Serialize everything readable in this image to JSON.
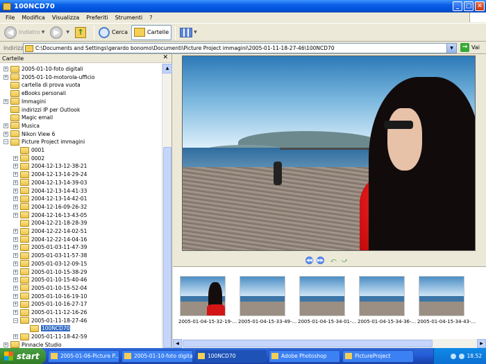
{
  "window": {
    "title": "100NCD70"
  },
  "menu": [
    "File",
    "Modifica",
    "Visualizza",
    "Preferiti",
    "Strumenti",
    "?"
  ],
  "toolbar": {
    "back": "Indietro",
    "search": "Cerca",
    "folders": "Cartelle"
  },
  "address": {
    "label": "Indirizzo",
    "path": "C:\\Documents and Settings\\gerardo bonomo\\Documenti\\Picture Project immagini\\2005-01-11-18-27-46\\100NCD70",
    "go": "Vai"
  },
  "left_pane": {
    "title": "Cartelle"
  },
  "tree": [
    {
      "label": "2005-01-10-foto digitali",
      "level": 1,
      "expand": "+"
    },
    {
      "label": "2005-01-10-motorola-ufficio",
      "level": 1,
      "expand": "+"
    },
    {
      "label": "cartella di prova vuota",
      "level": 1,
      "expand": ""
    },
    {
      "label": "eBooks personali",
      "level": 1,
      "expand": ""
    },
    {
      "label": "Immagini",
      "level": 1,
      "expand": "+"
    },
    {
      "label": "indirizzi IP per Outlook",
      "level": 1,
      "expand": ""
    },
    {
      "label": "Magic email",
      "level": 1,
      "expand": ""
    },
    {
      "label": "Musica",
      "level": 1,
      "expand": "+"
    },
    {
      "label": "Nikon View 6",
      "level": 1,
      "expand": "+"
    },
    {
      "label": "Picture Project immagini",
      "level": 1,
      "expand": "−"
    },
    {
      "label": "0001",
      "level": 2,
      "expand": ""
    },
    {
      "label": "0002",
      "level": 2,
      "expand": "+"
    },
    {
      "label": "2004-12-13-12-38-21",
      "level": 2,
      "expand": "+"
    },
    {
      "label": "2004-12-13-14-29-24",
      "level": 2,
      "expand": "+"
    },
    {
      "label": "2004-12-13-14-39-03",
      "level": 2,
      "expand": "+"
    },
    {
      "label": "2004-12-13-14-41-33",
      "level": 2,
      "expand": "+"
    },
    {
      "label": "2004-12-13-14-42-01",
      "level": 2,
      "expand": "+"
    },
    {
      "label": "2004-12-16-09-26-32",
      "level": 2,
      "expand": "+"
    },
    {
      "label": "2004-12-16-13-43-05",
      "level": 2,
      "expand": "+"
    },
    {
      "label": "2004-12-21-18-28-39",
      "level": 2,
      "expand": ""
    },
    {
      "label": "2004-12-22-14-02-51",
      "level": 2,
      "expand": "+"
    },
    {
      "label": "2004-12-22-14-04-16",
      "level": 2,
      "expand": "+"
    },
    {
      "label": "2005-01-03-11-47-39",
      "level": 2,
      "expand": "+"
    },
    {
      "label": "2005-01-03-11-57-38",
      "level": 2,
      "expand": "+"
    },
    {
      "label": "2005-01-03-12-09-15",
      "level": 2,
      "expand": "+"
    },
    {
      "label": "2005-01-10-15-38-29",
      "level": 2,
      "expand": "+"
    },
    {
      "label": "2005-01-10-15-40-46",
      "level": 2,
      "expand": "+"
    },
    {
      "label": "2005-01-10-15-52-04",
      "level": 2,
      "expand": "+"
    },
    {
      "label": "2005-01-10-16-19-10",
      "level": 2,
      "expand": "+"
    },
    {
      "label": "2005-01-10-16-27-17",
      "level": 2,
      "expand": "+"
    },
    {
      "label": "2005-01-11-12-16-26",
      "level": 2,
      "expand": "+"
    },
    {
      "label": "2005-01-11-18-27-46",
      "level": 2,
      "expand": "−"
    },
    {
      "label": "100NCD70",
      "level": 3,
      "expand": "",
      "selected": true
    },
    {
      "label": "2005-01-11-18-42-59",
      "level": 2,
      "expand": "+"
    },
    {
      "label": "Pinnacle Studio",
      "level": 1,
      "expand": "+"
    }
  ],
  "thumbnails": [
    {
      "caption": "2005-01-04-15-32-19-..."
    },
    {
      "caption": "2005-01-04-15-33-49-..."
    },
    {
      "caption": "2005-01-04-15-34-01-..."
    },
    {
      "caption": "2005-01-04-15-34-36-..."
    },
    {
      "caption": "2005-01-04-15-34-43-..."
    }
  ],
  "taskbar": {
    "start": "start",
    "tasks": [
      {
        "label": "2005-01-06-Picture P..."
      },
      {
        "label": "2005-01-10-foto digitali"
      },
      {
        "label": "100NCD70",
        "active": true
      },
      {
        "label": "Adobe Photoshop"
      },
      {
        "label": "PictureProject"
      }
    ],
    "clock": "18.52"
  },
  "colors": {
    "titlebar": "#0a5fe6",
    "taskbar": "#245edb",
    "start": "#3c8c32",
    "selection": "#316ac5"
  }
}
